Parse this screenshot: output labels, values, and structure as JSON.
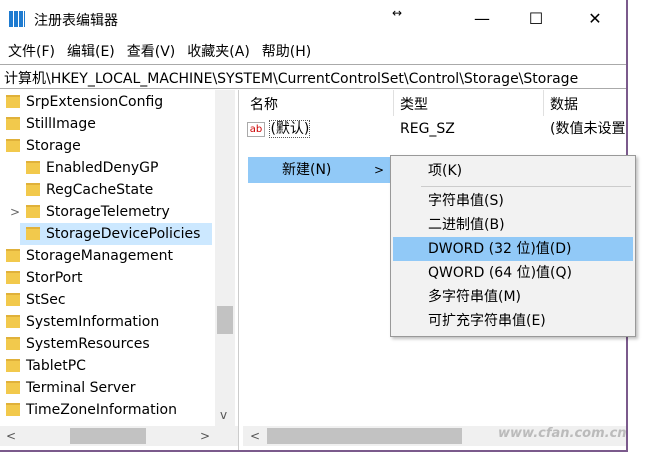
{
  "window": {
    "title": "注册表编辑器",
    "min": "—",
    "max": "☐",
    "close": "✕",
    "resize": "↔"
  },
  "menu": [
    "文件(F)",
    "编辑(E)",
    "查看(V)",
    "收藏夹(A)",
    "帮助(H)"
  ],
  "address": "计算机\\HKEY_LOCAL_MACHINE\\SYSTEM\\CurrentControlSet\\Control\\Storage\\Storage",
  "tree": [
    "SrpExtensionConfig",
    "StillImage",
    "Storage",
    "EnabledDenyGP",
    "RegCacheState",
    "StorageTelemetry",
    "StorageDevicePolicies",
    "StorageManagement",
    "StorPort",
    "StSec",
    "SystemInformation",
    "SystemResources",
    "TabletPC",
    "Terminal Server",
    "TimeZoneInformation"
  ],
  "tree_expander": ">",
  "scroll": {
    "left": "<",
    "right": ">",
    "down": "v"
  },
  "list": {
    "headers": [
      "名称",
      "类型",
      "数据"
    ],
    "row": {
      "icon": "ab",
      "name": "(默认)",
      "type": "REG_SZ",
      "data": "(数值未设置"
    }
  },
  "context": {
    "new_label": "新建(N)",
    "submenu_arrow": ">",
    "items": [
      "项(K)",
      "字符串值(S)",
      "二进制值(B)",
      "DWORD (32 位)值(D)",
      "QWORD (64 位)值(Q)",
      "多字符串值(M)",
      "可扩充字符串值(E)"
    ]
  },
  "watermark": "www.cfan.com.cn"
}
